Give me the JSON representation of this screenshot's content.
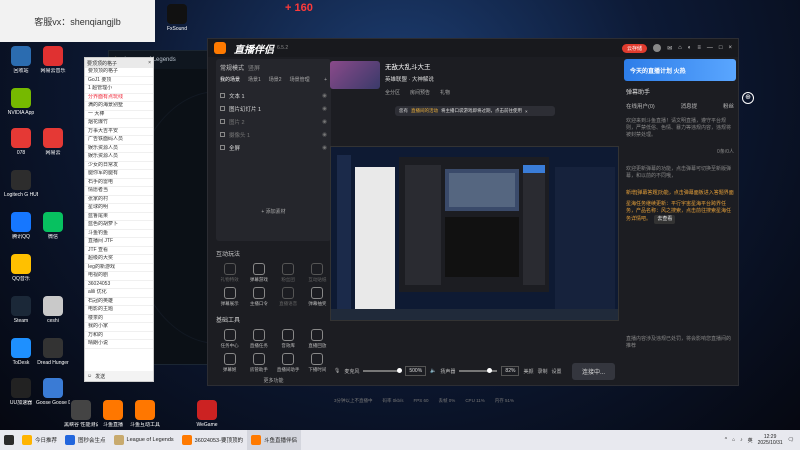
{
  "desktop": {
    "banner_text": "客服vx：shenqiangjlb",
    "top_red_text": "+ 160",
    "icons": [
      {
        "label": "FxSound",
        "color": "#111111"
      },
      {
        "label": "回收站",
        "color": "#2b6cb0"
      },
      {
        "label": "网易云音乐",
        "color": "#e03131"
      },
      {
        "label": "NVIDIA App",
        "color": "#76b900"
      },
      {
        "label": "078",
        "color": "#e53935"
      },
      {
        "label": "网易云",
        "color": "#e53935"
      },
      {
        "label": "Logitech G HUB",
        "color": "#2d2d2d"
      },
      {
        "label": "腾讯QQ",
        "color": "#1677ff"
      },
      {
        "label": "微信",
        "color": "#07c160"
      },
      {
        "label": "QQ音乐",
        "color": "#ffc000"
      },
      {
        "label": "Steam",
        "color": "#1b2838"
      },
      {
        "label": "ceshi",
        "color": "#c9c9c9"
      },
      {
        "label": "ToDesk",
        "color": "#1e90ff"
      },
      {
        "label": "Dread Hunger",
        "color": "#333333"
      },
      {
        "label": "UU加速器",
        "color": "#222222"
      },
      {
        "label": "Goose Goose Duck",
        "color": "#3a7bd5"
      },
      {
        "label": "黑峡谷 性能测试工具",
        "color": "#444444"
      },
      {
        "label": "斗鱼直播",
        "color": "#ff7700"
      },
      {
        "label": "斗鱼互动工具",
        "color": "#ff7700"
      },
      {
        "label": "WeGame",
        "color": "#cc2222"
      }
    ]
  },
  "lol_window": {
    "title": "League of Legends"
  },
  "chat_window": {
    "title": "要顶顶的格子",
    "rows": [
      {
        "text": "要顶顶的格子",
        "red": false
      },
      {
        "text": "GoJ1 要顶",
        "red": false
      },
      {
        "text": "1 超管理小",
        "red": false
      },
      {
        "text": "分界面有点玩线",
        "red": true
      },
      {
        "text": "满的的海景别墅",
        "red": false
      },
      {
        "text": "一 大棒",
        "red": false
      },
      {
        "text": "烟花爆竹",
        "red": false
      },
      {
        "text": "万事大吉平安",
        "red": false
      },
      {
        "text": "广告铁面码人员",
        "red": false
      },
      {
        "text": "娱乐资源人员",
        "red": false
      },
      {
        "text": "娱乐资源人员",
        "red": false
      },
      {
        "text": "少女的日常发",
        "red": false
      },
      {
        "text": "腿你军的腿有",
        "red": false
      },
      {
        "text": "石手的雷电",
        "red": false
      },
      {
        "text": "情愿者当",
        "red": false
      },
      {
        "text": "张家的村",
        "red": false
      },
      {
        "text": "星球的明",
        "red": false
      },
      {
        "text": "蓝鲁尾果",
        "red": false
      },
      {
        "text": "蓝色的胡萝卜",
        "red": false
      },
      {
        "text": "斗鱼钓鱼",
        "red": false
      },
      {
        "text": "直播间 JTF",
        "red": false
      },
      {
        "text": "JTF 查看",
        "red": false
      },
      {
        "text": "超级的大奖",
        "red": false
      },
      {
        "text": "Ieg的新游戏",
        "red": false
      },
      {
        "text": "电视的剧",
        "red": false
      },
      {
        "text": "36024053",
        "red": false
      },
      {
        "text": "alili 优化",
        "red": false
      },
      {
        "text": "石冠的英雄",
        "red": false
      },
      {
        "text": "电影的主题",
        "red": false
      },
      {
        "text": "楼茶的",
        "red": false
      },
      {
        "text": "我的小家",
        "red": false
      },
      {
        "text": "万和的",
        "red": false
      },
      {
        "text": "晴朗小说",
        "red": false
      }
    ],
    "footer_btn": "发送"
  },
  "app": {
    "logo_text": "直播伴侣",
    "version": "6.5.2",
    "window_buttons": {
      "upgrade": "云存储",
      "min": "—",
      "max": "□",
      "close": "×"
    },
    "left": {
      "tab_scene": "常规模式",
      "tab_game": "竖屏",
      "sub_tabs": [
        "我的场景",
        "场景1",
        "场景2",
        "场景管理"
      ],
      "sources": [
        {
          "label": "文本 1",
          "dim": false
        },
        {
          "label": "图片幻灯片 1",
          "dim": false
        },
        {
          "label": "图片 2",
          "dim": true
        },
        {
          "label": "摄像头 1",
          "dim": true
        },
        {
          "label": "全屏",
          "dim": false
        }
      ],
      "add_material": "+ 添加素材",
      "interact_title": "互动玩法",
      "interact_items": [
        {
          "label": "礼物特效",
          "dim": true
        },
        {
          "label": "弹幕游戏",
          "dim": false
        },
        {
          "label": "粉丝团",
          "dim": true
        },
        {
          "label": "互动贴纸",
          "dim": true
        },
        {
          "label": "弹幕展示",
          "dim": false
        },
        {
          "label": "主播口令",
          "dim": false
        },
        {
          "label": "直播语音",
          "dim": true
        },
        {
          "label": "弹幕抽奖",
          "dim": false
        }
      ],
      "tools_title": "基础工具",
      "tool_items": [
        {
          "label": "任务中心",
          "dim": false
        },
        {
          "label": "直播任务",
          "dim": false
        },
        {
          "label": "音效库",
          "dim": false
        },
        {
          "label": "直播回放",
          "dim": false
        },
        {
          "label": "弹幕姬",
          "dim": false
        },
        {
          "label": "房管助手",
          "dim": false
        },
        {
          "label": "直播间助手",
          "dim": false
        },
        {
          "label": "下播时间",
          "dim": false
        }
      ],
      "more": "更多功能"
    },
    "center": {
      "room_title": "无敌大乱斗大王",
      "room_sub": "英雄联盟 · 大神解说",
      "meta": [
        "全分区",
        "房间预告",
        "礼物"
      ],
      "notice_prefix": "您有",
      "notice_hl": "直播间的活动",
      "notice_rest": "将主播口袋游戏即将过期，点击前往使用",
      "mic_label": "麦克风",
      "mic_value": "500%",
      "speaker_label": "扬声器",
      "speaker_value": "82%",
      "btn_beauty": "美颜",
      "btn_record": "录制",
      "btn_settings": "设置",
      "live_button": "连接中...",
      "status": [
        "3分钟以上不直播中",
        "码率 0kb/s",
        "FPS 60",
        "丢帧 0%",
        "CPU 11%",
        "内存 51%"
      ]
    },
    "right": {
      "banner": "今天的直播计划 火热",
      "section_title": "弹幕助手",
      "tabs": [
        "在线用户(0)",
        "消息提",
        "粉丝"
      ],
      "msg1": "欢迎来到斗鱼直播！请文明直播，遵守平台规则，严禁低俗、色情、暴力等违规内容，违规将被封禁处理。",
      "hint": "0条/0人",
      "msg2_a": "欢迎更新弹幕的功能，点击弹幕可切换至新版弹幕，和以前的不同哦，",
      "sys1": "新增[弹幕答题]功能，点击弹幕面板进入答题界面",
      "sys2": "星海任务继续更新：平行宇宙星海平台跨界任务，产品名称：风之搜索，点击前往搜索星海任务详情吧。",
      "see_more": "去查看",
      "msg3": "直播内容涉及违规已处罚，将会影响您直播间的推荐"
    }
  },
  "taskbar": {
    "items": [
      {
        "label": "今日推荐",
        "sel": false
      },
      {
        "label": "图秒会生点",
        "sel": false
      },
      {
        "label": "League of Legends",
        "sel": false
      },
      {
        "label": "36024053-要顶顶的",
        "sel": false
      },
      {
        "label": "斗鱼直播伴侣",
        "sel": true
      }
    ],
    "ime": "英",
    "time": "12:29",
    "date": "2025/10/31"
  }
}
